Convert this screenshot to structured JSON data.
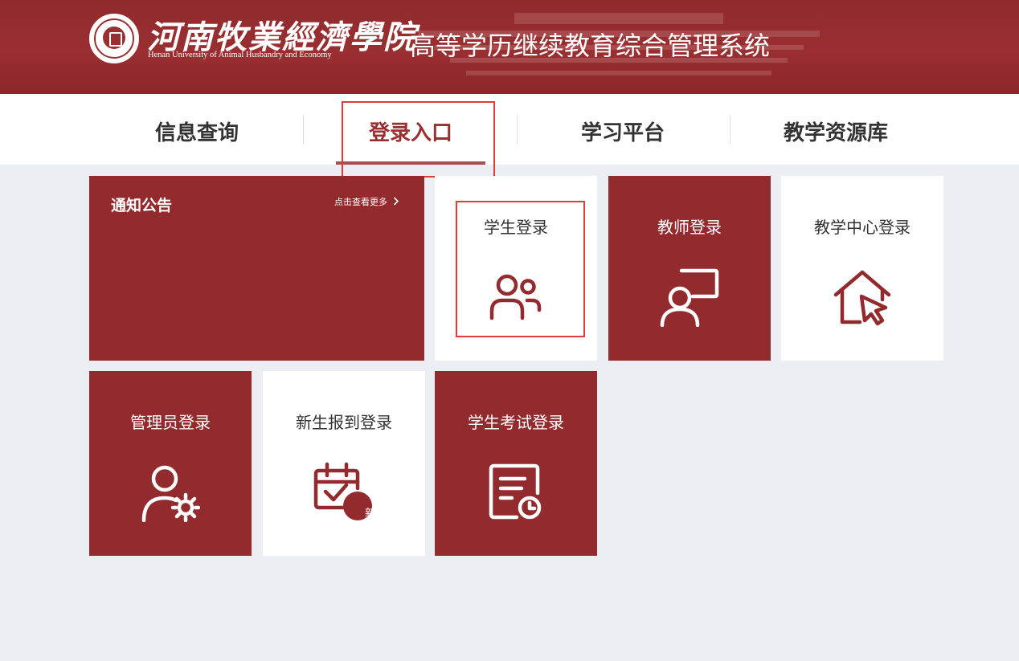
{
  "header": {
    "school_name_cn": "河南牧業經濟學院",
    "school_name_en": "Henan University of Animal Husbandry and Economy",
    "system_title": "高等学历继续教育综合管理系统"
  },
  "nav": {
    "items": [
      {
        "label": "信息查询"
      },
      {
        "label": "登录入口"
      },
      {
        "label": "学习平台"
      },
      {
        "label": "教学资源库"
      }
    ],
    "active_index": 1
  },
  "notice": {
    "title": "通知公告",
    "more_label": "点击查看更多",
    "more_icon": "chevron-right-icon"
  },
  "tiles": [
    {
      "label": "学生登录",
      "icon": "students-icon",
      "style": "white"
    },
    {
      "label": "教师登录",
      "icon": "teacher-icon",
      "style": "red"
    },
    {
      "label": "教学中心登录",
      "icon": "home-cursor-icon",
      "style": "white"
    },
    {
      "label": "管理员登录",
      "icon": "admin-gear-icon",
      "style": "red"
    },
    {
      "label": "新生报到登录",
      "icon": "calendar-new-icon",
      "style": "white",
      "badge": "新"
    },
    {
      "label": "学生考试登录",
      "icon": "exam-clock-icon",
      "style": "red"
    }
  ],
  "colors": {
    "brand_red": "#932a2d",
    "highlight_red": "#e23b3b",
    "page_bg": "#ebeef3"
  }
}
